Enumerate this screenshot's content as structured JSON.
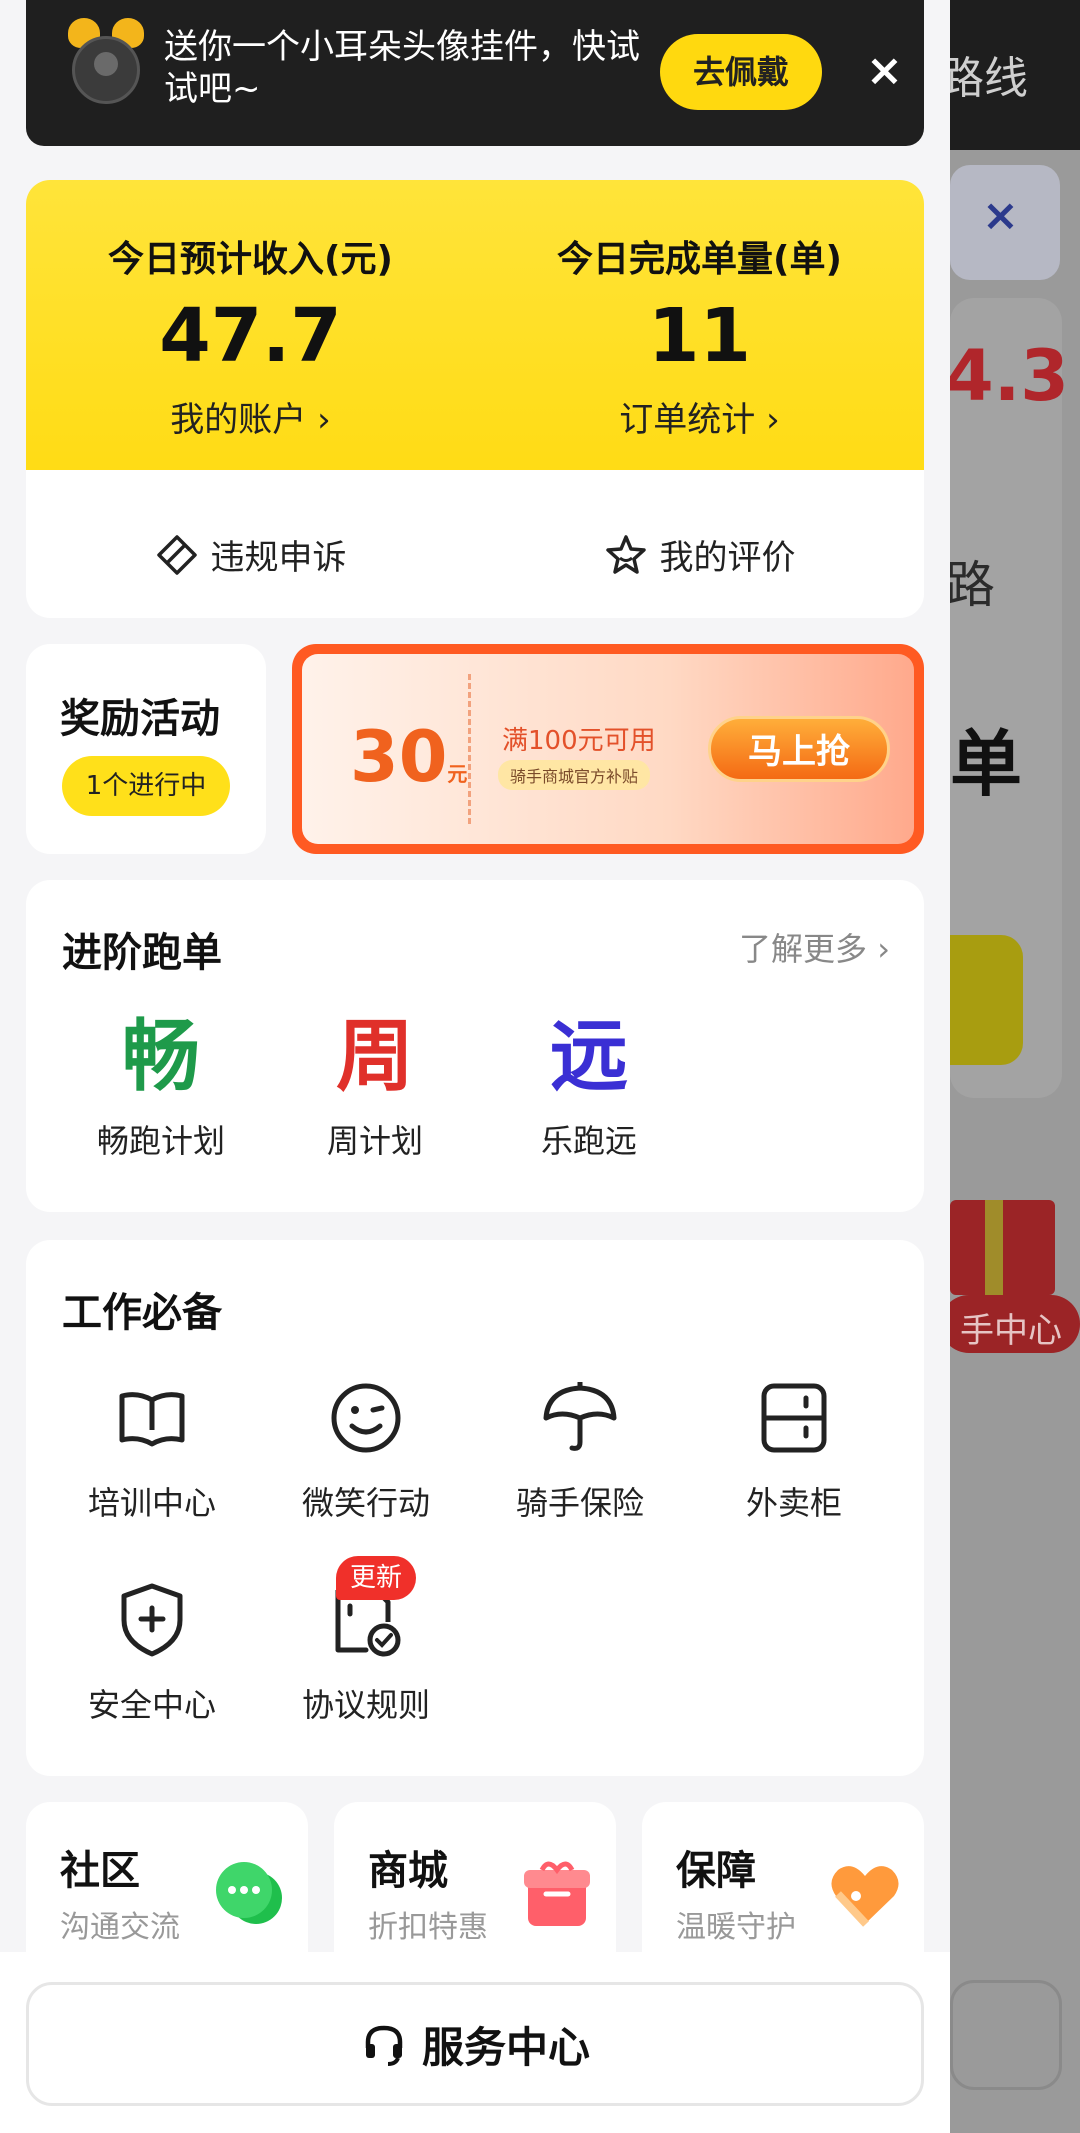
{
  "background": {
    "top_text": "路线",
    "close": "×",
    "number": "4.3",
    "lu": "路",
    "dan": "单",
    "pill": "手中心"
  },
  "notice": {
    "text": "送你一个小耳朵头像挂件，快试试吧~",
    "button": "去佩戴",
    "close": "×"
  },
  "income": {
    "left_label": "今日预计收入(元)",
    "left_value": "47.7",
    "left_link": "我的账户 ›",
    "right_label": "今日完成单量(单)",
    "right_value": "11",
    "right_link": "订单统计 ›"
  },
  "actions": {
    "appeal": "违规申诉",
    "rating": "我的评价"
  },
  "reward": {
    "title": "奖励活动",
    "status": "1个进行中"
  },
  "coupon": {
    "amount": "30",
    "unit": "元",
    "condition": "满100元可用",
    "subsidy": "骑手商城官方补贴",
    "button": "马上抢"
  },
  "advanced": {
    "title": "进阶跑单",
    "more": "了解更多 ›",
    "items": [
      {
        "glyph": "畅",
        "label": "畅跑计划",
        "color": "#1e9a4a"
      },
      {
        "glyph": "周",
        "label": "周计划",
        "color": "#e0302a"
      },
      {
        "glyph": "远",
        "label": "乐跑远",
        "color": "#3a2fd4"
      }
    ]
  },
  "work": {
    "title": "工作必备",
    "tools": [
      {
        "label": "培训中心",
        "icon": "book-icon"
      },
      {
        "label": "微笑行动",
        "icon": "smile-icon"
      },
      {
        "label": "骑手保险",
        "icon": "umbrella-icon"
      },
      {
        "label": "外卖柜",
        "icon": "locker-icon"
      },
      {
        "label": "安全中心",
        "icon": "shield-icon"
      },
      {
        "label": "协议规则",
        "icon": "document-icon"
      }
    ],
    "badge": "更新"
  },
  "mini": [
    {
      "title": "社区",
      "sub": "沟通交流",
      "icon": "chat-icon"
    },
    {
      "title": "商城",
      "sub": "折扣特惠",
      "icon": "gift-box-icon"
    },
    {
      "title": "保障",
      "sub": "温暖守护",
      "icon": "heart-icon"
    }
  ],
  "service": {
    "label": "服务中心"
  },
  "colors": {
    "brand_yellow": "#ffdb12",
    "coupon_orange": "#ff5a22",
    "badge_red": "#f0302a"
  }
}
